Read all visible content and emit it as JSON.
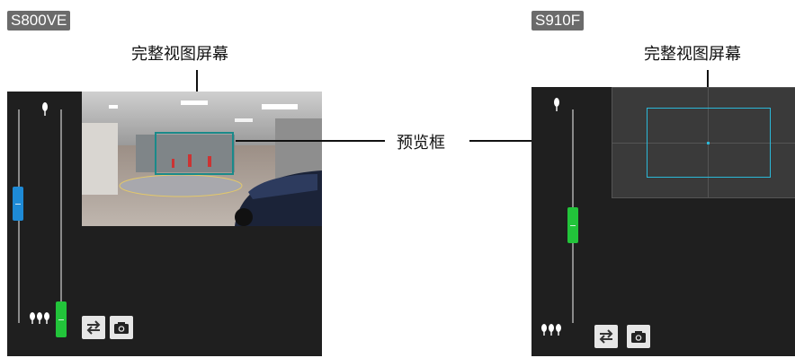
{
  "left_view": {
    "model": "S800VE",
    "screen_label": "完整视图屏幕",
    "icons": {
      "far": "tree-single-icon",
      "near": "tree-triple-icon",
      "switch": "swap-arrows-icon",
      "snapshot": "camera-icon"
    },
    "colors": {
      "slider_blue": "#1e8ad6",
      "slider_green": "#22c43a",
      "preview_frame": "#1a8a8a"
    }
  },
  "right_view": {
    "model": "S910F",
    "screen_label": "完整视图屏幕",
    "icons": {
      "far": "tree-single-icon",
      "near": "tree-triple-icon",
      "switch": "swap-arrows-icon",
      "snapshot": "camera-icon"
    },
    "colors": {
      "slider_green": "#22c43a",
      "preview_frame": "#2bb8d8"
    }
  },
  "callout": {
    "label": "预览框"
  }
}
